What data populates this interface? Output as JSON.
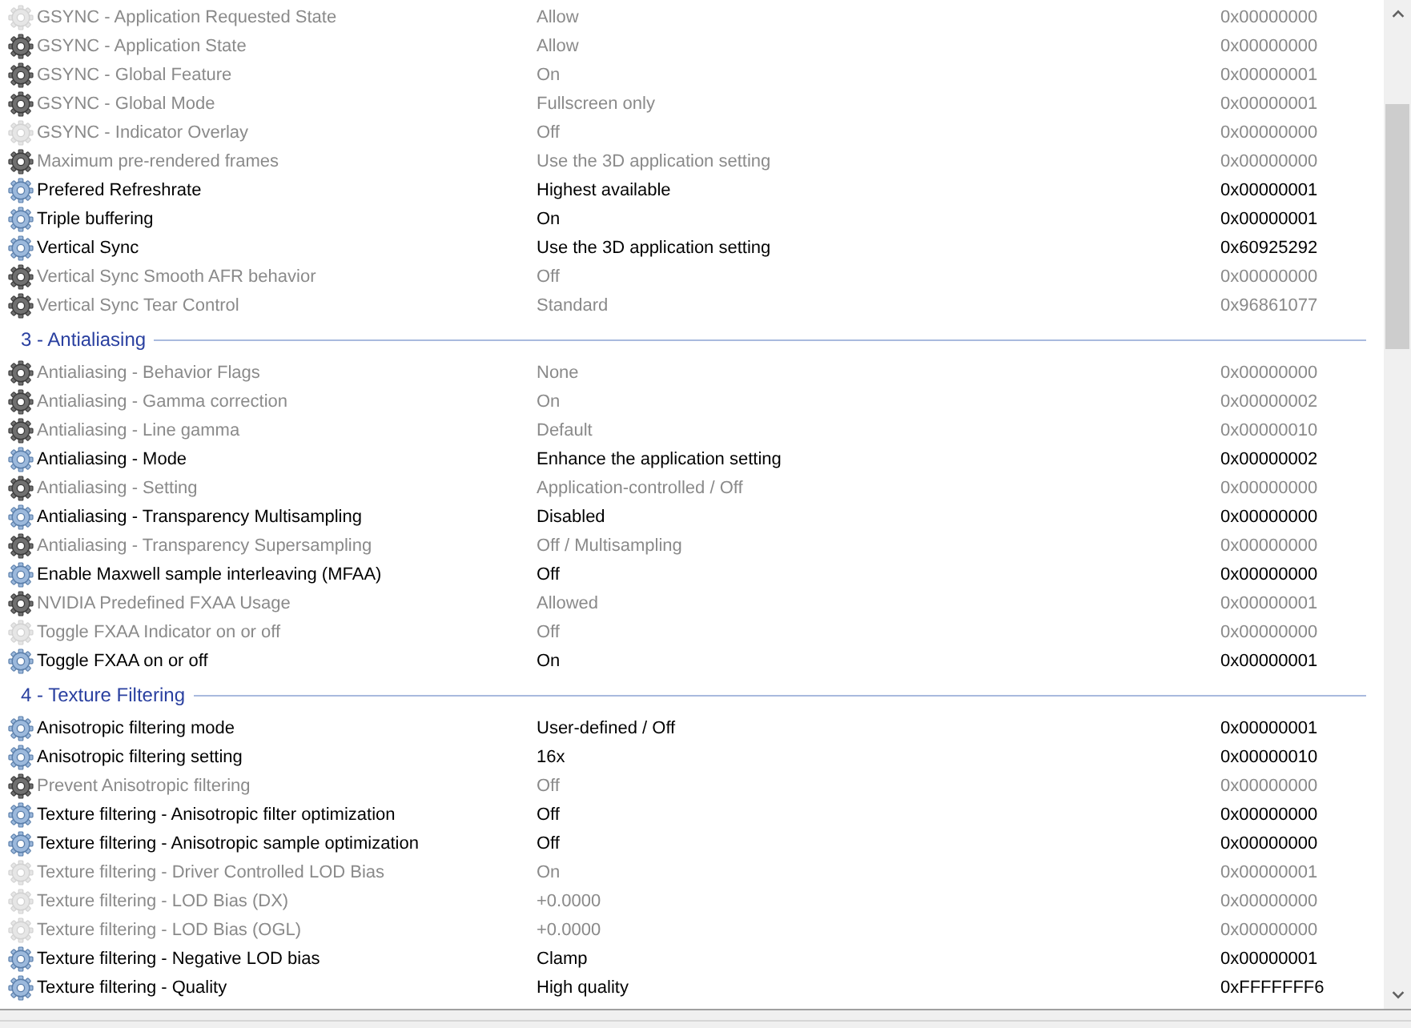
{
  "settings_list": {
    "groups": [
      {
        "rows": [
          {
            "name": "GSYNC - Application Requested State",
            "value": "Allow",
            "hex": "0x00000000",
            "kind": "unset"
          },
          {
            "name": "GSYNC - Application State",
            "value": "Allow",
            "hex": "0x00000000",
            "kind": "predefined"
          },
          {
            "name": "GSYNC - Global Feature",
            "value": "On",
            "hex": "0x00000001",
            "kind": "predefined"
          },
          {
            "name": "GSYNC - Global Mode",
            "value": "Fullscreen only",
            "hex": "0x00000001",
            "kind": "predefined"
          },
          {
            "name": "GSYNC - Indicator Overlay",
            "value": "Off",
            "hex": "0x00000000",
            "kind": "unset"
          },
          {
            "name": "Maximum pre-rendered frames",
            "value": "Use the 3D application setting",
            "hex": "0x00000000",
            "kind": "predefined"
          },
          {
            "name": "Prefered Refreshrate",
            "value": "Highest available",
            "hex": "0x00000001",
            "kind": "user"
          },
          {
            "name": "Triple buffering",
            "value": "On",
            "hex": "0x00000001",
            "kind": "user"
          },
          {
            "name": "Vertical Sync",
            "value": "Use the 3D application setting",
            "hex": "0x60925292",
            "kind": "user"
          },
          {
            "name": "Vertical Sync Smooth AFR behavior",
            "value": "Off",
            "hex": "0x00000000",
            "kind": "predefined"
          },
          {
            "name": "Vertical Sync Tear Control",
            "value": "Standard",
            "hex": "0x96861077",
            "kind": "predefined"
          }
        ]
      },
      {
        "title": "3 - Antialiasing",
        "rows": [
          {
            "name": "Antialiasing - Behavior Flags",
            "value": "None",
            "hex": "0x00000000",
            "kind": "predefined"
          },
          {
            "name": "Antialiasing - Gamma correction",
            "value": "On",
            "hex": "0x00000002",
            "kind": "predefined"
          },
          {
            "name": "Antialiasing - Line gamma",
            "value": "Default",
            "hex": "0x00000010",
            "kind": "predefined"
          },
          {
            "name": "Antialiasing - Mode",
            "value": "Enhance the application setting",
            "hex": "0x00000002",
            "kind": "user"
          },
          {
            "name": "Antialiasing - Setting",
            "value": "Application-controlled / Off",
            "hex": "0x00000000",
            "kind": "predefined"
          },
          {
            "name": "Antialiasing - Transparency Multisampling",
            "value": "Disabled",
            "hex": "0x00000000",
            "kind": "user"
          },
          {
            "name": "Antialiasing - Transparency Supersampling",
            "value": "Off / Multisampling",
            "hex": "0x00000000",
            "kind": "predefined"
          },
          {
            "name": "Enable Maxwell sample interleaving (MFAA)",
            "value": "Off",
            "hex": "0x00000000",
            "kind": "user"
          },
          {
            "name": "NVIDIA Predefined FXAA Usage",
            "value": "Allowed",
            "hex": "0x00000001",
            "kind": "predefined"
          },
          {
            "name": "Toggle FXAA Indicator on or off",
            "value": "Off",
            "hex": "0x00000000",
            "kind": "unset"
          },
          {
            "name": "Toggle FXAA on or off",
            "value": "On",
            "hex": "0x00000001",
            "kind": "user"
          }
        ]
      },
      {
        "title": "4 - Texture Filtering",
        "rows": [
          {
            "name": "Anisotropic filtering mode",
            "value": "User-defined / Off",
            "hex": "0x00000001",
            "kind": "user"
          },
          {
            "name": "Anisotropic filtering setting",
            "value": "16x",
            "hex": "0x00000010",
            "kind": "user"
          },
          {
            "name": "Prevent Anisotropic filtering",
            "value": "Off",
            "hex": "0x00000000",
            "kind": "predefined"
          },
          {
            "name": "Texture filtering - Anisotropic filter optimization",
            "value": "Off",
            "hex": "0x00000000",
            "kind": "user"
          },
          {
            "name": "Texture filtering - Anisotropic sample optimization",
            "value": "Off",
            "hex": "0x00000000",
            "kind": "user"
          },
          {
            "name": "Texture filtering - Driver Controlled LOD Bias",
            "value": "On",
            "hex": "0x00000001",
            "kind": "unset"
          },
          {
            "name": "Texture filtering - LOD Bias (DX)",
            "value": "+0.0000",
            "hex": "0x00000000",
            "kind": "unset"
          },
          {
            "name": "Texture filtering - LOD Bias (OGL)",
            "value": "+0.0000",
            "hex": "0x00000000",
            "kind": "unset"
          },
          {
            "name": "Texture filtering - Negative LOD bias",
            "value": "Clamp",
            "hex": "0x00000001",
            "kind": "user"
          },
          {
            "name": "Texture filtering - Quality",
            "value": "High quality",
            "hex": "0xFFFFFFF6",
            "kind": "user"
          }
        ]
      }
    ]
  }
}
